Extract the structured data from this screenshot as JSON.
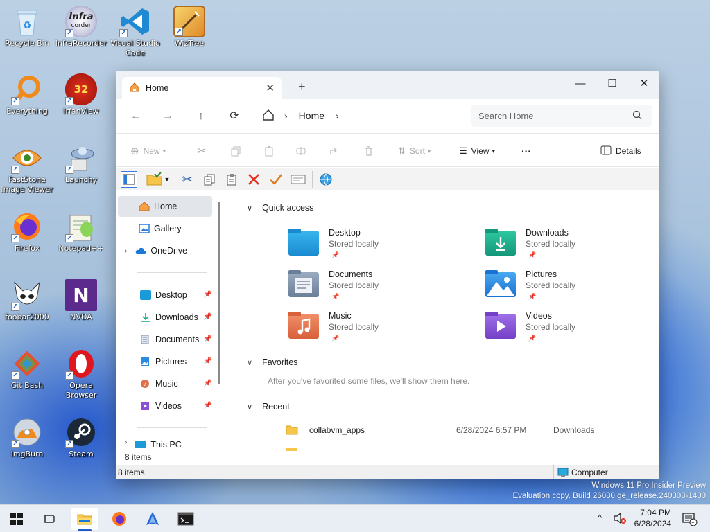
{
  "desktop": {
    "icons": [
      {
        "label": "Recycle Bin",
        "icon": "recycle-bin-icon"
      },
      {
        "label": "InfraRecorder",
        "icon": "infrarecorder-icon"
      },
      {
        "label": "Visual Studio Code",
        "icon": "vscode-icon"
      },
      {
        "label": "WizTree",
        "icon": "wiztree-icon"
      },
      {
        "label": "Everything",
        "icon": "everything-icon"
      },
      {
        "label": "IrfanView",
        "icon": "irfanview-icon"
      },
      {
        "label": "FastStone Image Viewer",
        "icon": "faststone-icon"
      },
      {
        "label": "Launchy",
        "icon": "launchy-icon"
      },
      {
        "label": "Firefox",
        "icon": "firefox-icon"
      },
      {
        "label": "Notepad++",
        "icon": "notepadpp-icon"
      },
      {
        "label": "foobar2000",
        "icon": "foobar2000-icon"
      },
      {
        "label": "NVDA",
        "icon": "nvda-icon"
      },
      {
        "label": "Git Bash",
        "icon": "git-bash-icon"
      },
      {
        "label": "Opera Browser",
        "icon": "opera-icon"
      },
      {
        "label": "ImgBurn",
        "icon": "imgburn-icon"
      },
      {
        "label": "Steam",
        "icon": "steam-icon"
      }
    ],
    "infra_logo_text": "Infra",
    "infra_logo_sub": "corder",
    "irfan_badge": "32",
    "nvda_text": "N",
    "shortcut_arrow": "↗"
  },
  "explorer": {
    "tab_title": "Home",
    "tab_close": "✕",
    "new_tab": "+",
    "window_controls": {
      "minimize": "—",
      "maximize": "☐",
      "close": "✕"
    },
    "nav": {
      "back": "←",
      "forward": "→",
      "up": "↑",
      "refresh": "⟳"
    },
    "address": {
      "sep1": "›",
      "location": "Home",
      "sep2": "›"
    },
    "search_placeholder": "Search Home",
    "commands": {
      "new": "New",
      "sort": "Sort",
      "view": "View",
      "more": "···",
      "details": "Details"
    },
    "sidebar": {
      "items": [
        {
          "label": "Home",
          "icon": "home-icon",
          "selected": true
        },
        {
          "label": "Gallery",
          "icon": "gallery-icon"
        },
        {
          "label": "OneDrive",
          "icon": "onedrive-icon"
        },
        {
          "label": "Desktop",
          "icon": "desktop-folder-icon",
          "pinned": true
        },
        {
          "label": "Downloads",
          "icon": "downloads-folder-icon",
          "pinned": true
        },
        {
          "label": "Documents",
          "icon": "documents-folder-icon",
          "pinned": true
        },
        {
          "label": "Pictures",
          "icon": "pictures-folder-icon",
          "pinned": true
        },
        {
          "label": "Music",
          "icon": "music-folder-icon",
          "pinned": true
        },
        {
          "label": "Videos",
          "icon": "videos-folder-icon",
          "pinned": true
        },
        {
          "label": "This PC",
          "icon": "this-pc-icon"
        }
      ]
    },
    "quick_access": {
      "heading": "Quick access",
      "folders": [
        {
          "name": "Desktop",
          "status": "Stored locally",
          "color": "#1a9bd7"
        },
        {
          "name": "Downloads",
          "status": "Stored locally",
          "color": "#1aa88a"
        },
        {
          "name": "Documents",
          "status": "Stored locally",
          "color": "#7b8ea6"
        },
        {
          "name": "Pictures",
          "status": "Stored locally",
          "color": "#2a8ae0"
        },
        {
          "name": "Music",
          "status": "Stored locally",
          "color": "#e0704a"
        },
        {
          "name": "Videos",
          "status": "Stored locally",
          "color": "#8a4fd6"
        }
      ]
    },
    "favorites": {
      "heading": "Favorites",
      "empty_text": "After you've favorited some files, we'll show them here."
    },
    "recent": {
      "heading": "Recent",
      "items": [
        {
          "name": "collabvm_apps",
          "date": "6/28/2024 6:57 PM",
          "location": "Downloads"
        }
      ]
    },
    "item_count_inner": "8 items",
    "status_left": "8 items",
    "status_right": "Computer"
  },
  "watermark": {
    "line1": "Windows 11 Pro Insider Preview",
    "line2": "Evaluation copy. Build 26080.ge_release.240308-1400"
  },
  "taskbar": {
    "time": "7:04 PM",
    "date": "6/28/2024",
    "notification_count": "1"
  }
}
